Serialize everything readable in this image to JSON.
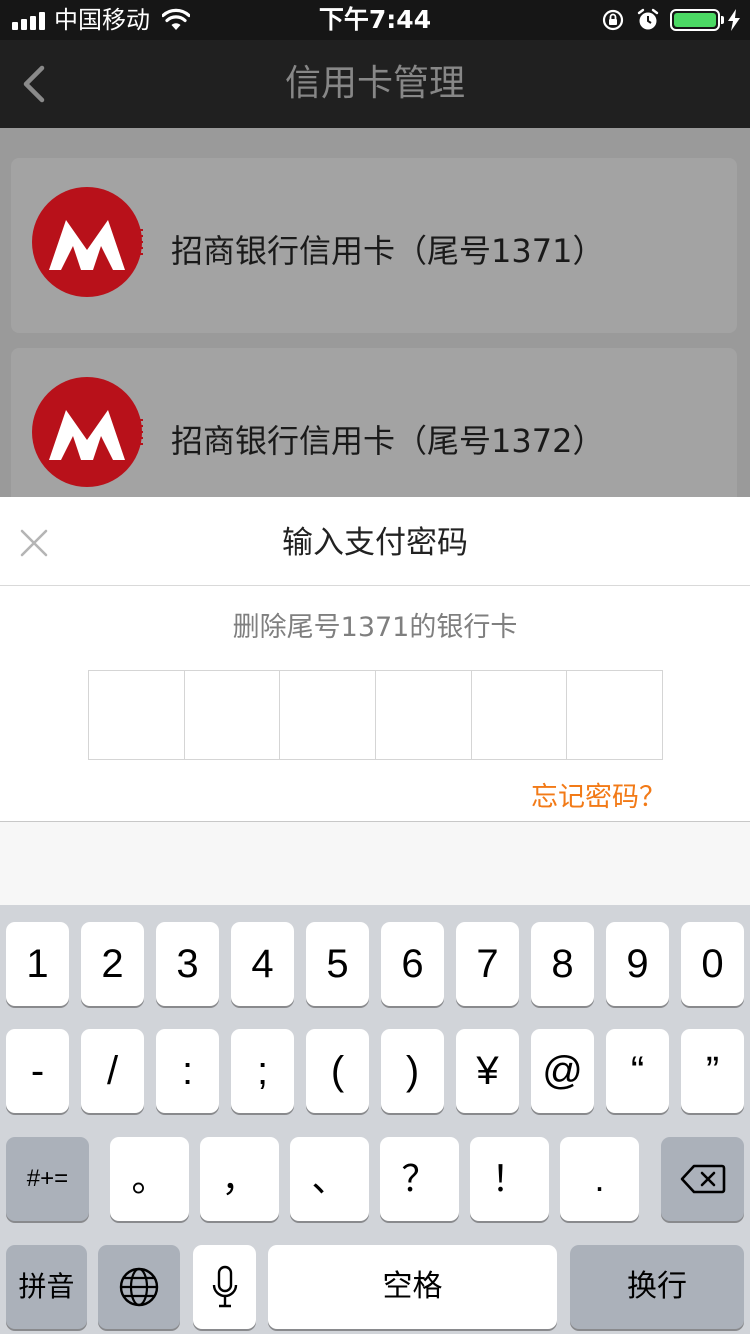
{
  "status_bar": {
    "carrier": "中国移动",
    "time": "下午7:44",
    "battery_level": 1.0,
    "icons": [
      "signal-icon",
      "wifi-icon",
      "rotation-lock-icon",
      "alarm-icon",
      "battery-icon",
      "charging-bolt-icon"
    ]
  },
  "nav": {
    "title": "信用卡管理",
    "back_icon": "chevron-left-icon"
  },
  "cards": [
    {
      "bank_logo": "cmb-logo-icon",
      "label": "招商银行信用卡（尾号1371）"
    },
    {
      "bank_logo": "cmb-logo-icon",
      "label": "招商银行信用卡（尾号1372）"
    }
  ],
  "password_sheet": {
    "close_icon": "close-icon",
    "title": "输入支付密码",
    "subtitle": "删除尾号1371的银行卡",
    "digit_count": 6,
    "forgot_label": "忘记密码？",
    "accent_color": "#f27a17"
  },
  "keyboard": {
    "row1": [
      "1",
      "2",
      "3",
      "4",
      "5",
      "6",
      "7",
      "8",
      "9",
      "0"
    ],
    "row2": [
      "-",
      "/",
      ":",
      ";",
      "(",
      ")",
      "¥",
      "@",
      "“",
      "”"
    ],
    "row3": {
      "symbols_key": "#+=",
      "keys": [
        "。",
        "，",
        "、",
        "？",
        "！",
        "."
      ],
      "delete_icon": "backspace-icon"
    },
    "row4": {
      "mode_key": "拼音",
      "globe_icon": "globe-icon",
      "mic_icon": "microphone-icon",
      "space_key": "空格",
      "return_key": "换行"
    }
  }
}
